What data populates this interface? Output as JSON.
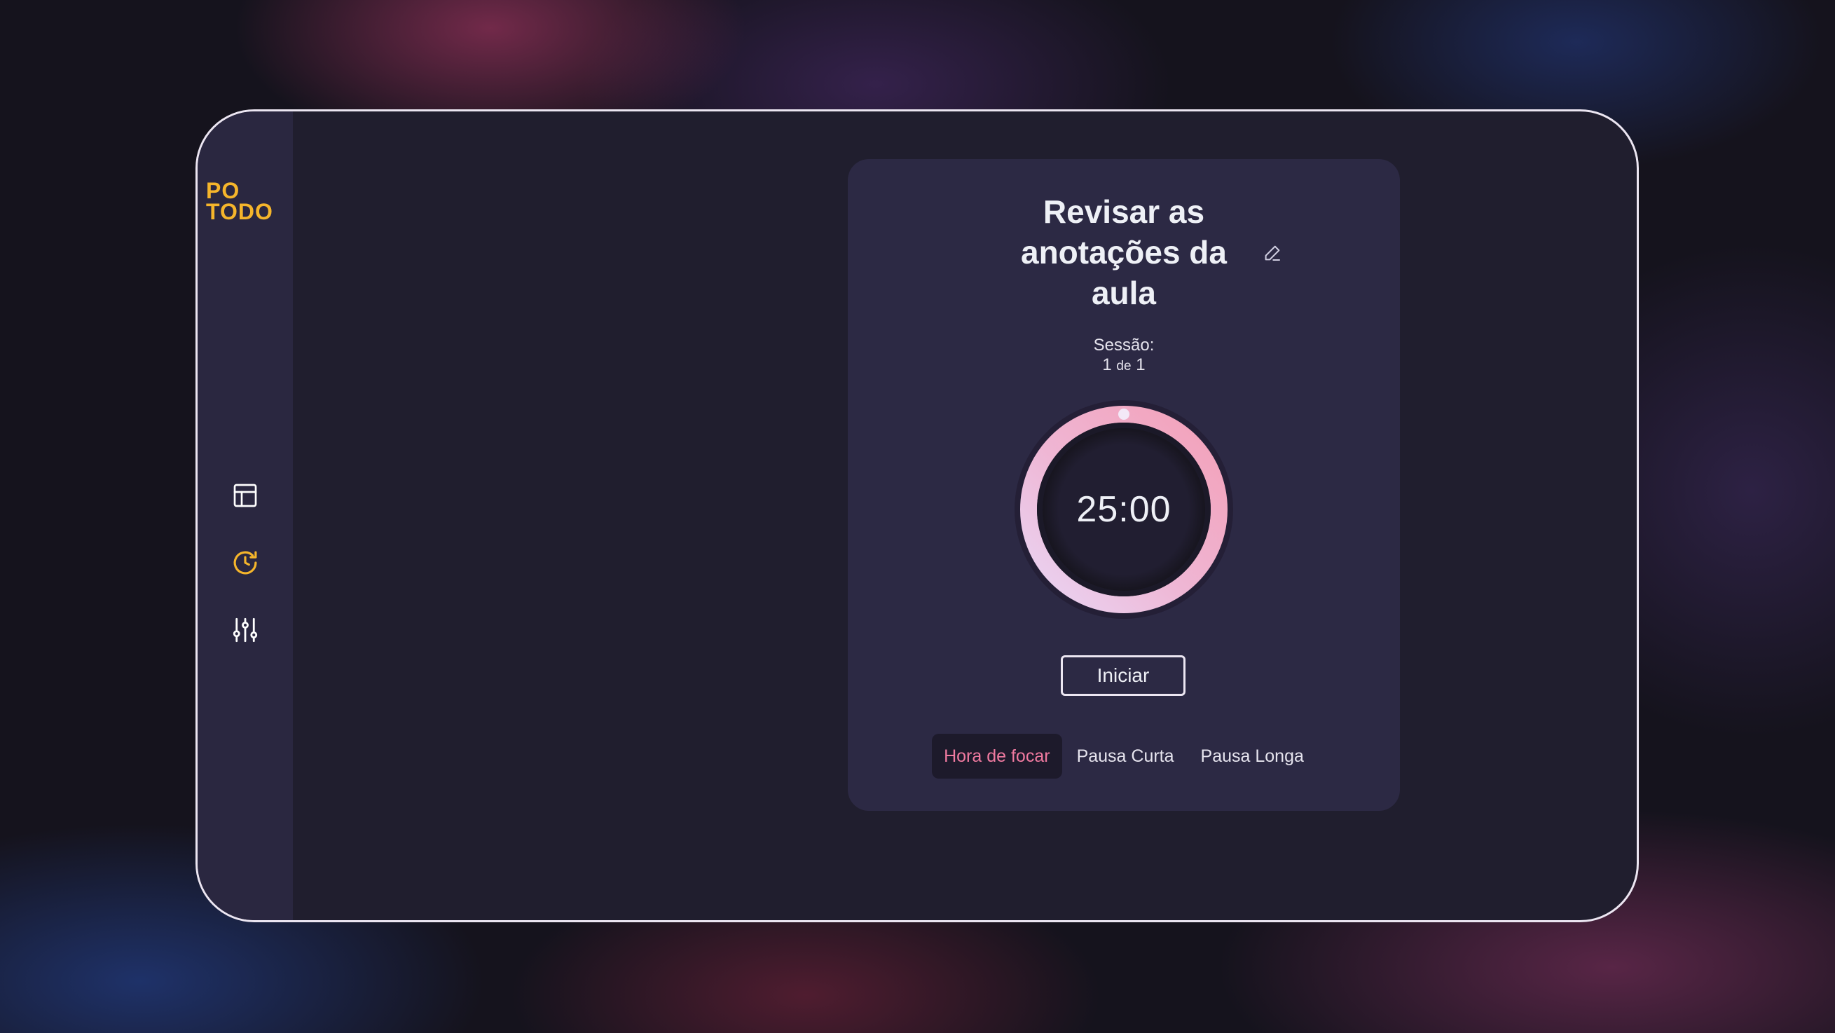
{
  "app": {
    "logo_line1": "PO",
    "logo_line2": "TODO"
  },
  "sidebar": {
    "items": [
      {
        "name": "dashboard",
        "icon": "layout-icon"
      },
      {
        "name": "pomodoro",
        "icon": "timer-refresh-icon",
        "active": true
      },
      {
        "name": "settings",
        "icon": "sliders-icon"
      }
    ]
  },
  "task": {
    "title": "Revisar as anotações da aula",
    "edit_icon": "pencil-icon"
  },
  "session": {
    "label": "Sessão:",
    "current": "1",
    "separator": "de",
    "total": "1"
  },
  "timer": {
    "display": "25:00",
    "progress": 0.0
  },
  "controls": {
    "start_label": "Iniciar"
  },
  "modes": [
    {
      "label": "Hora de focar",
      "active": true
    },
    {
      "label": "Pausa Curta",
      "active": false
    },
    {
      "label": "Pausa Longa",
      "active": false
    }
  ],
  "colors": {
    "accent": "#f5b52b",
    "active_mode": "#f07aa0",
    "ring_start": "#f3a0b8",
    "ring_end": "#e9d6f5",
    "card": "#2c2944",
    "sidebar": "#2a2740",
    "window": "#201e2e"
  }
}
